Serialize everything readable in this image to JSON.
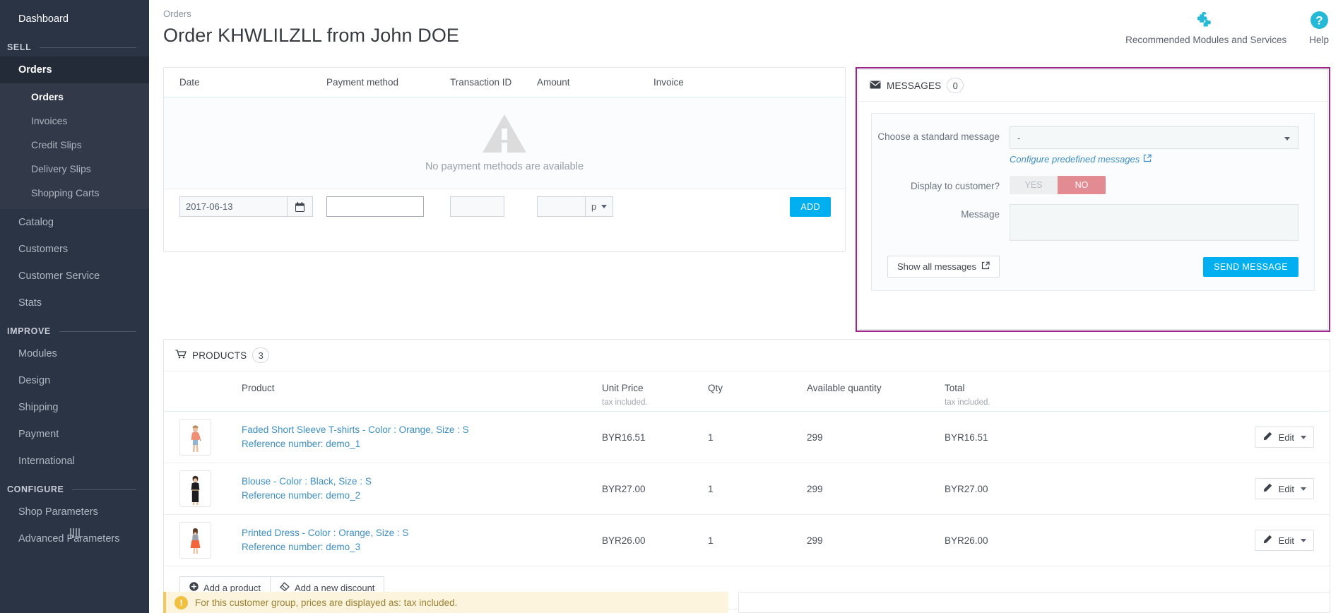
{
  "sidebar": {
    "dashboard": {
      "label": "Dashboard"
    },
    "sections": [
      {
        "title": "SELL",
        "items": [
          {
            "label": "Orders",
            "active": true,
            "submenu": [
              {
                "label": "Orders",
                "active": true
              },
              {
                "label": "Invoices",
                "active": false
              },
              {
                "label": "Credit Slips",
                "active": false
              },
              {
                "label": "Delivery Slips",
                "active": false
              },
              {
                "label": "Shopping Carts",
                "active": false
              }
            ]
          },
          {
            "label": "Catalog"
          },
          {
            "label": "Customers"
          },
          {
            "label": "Customer Service"
          },
          {
            "label": "Stats"
          }
        ]
      },
      {
        "title": "IMPROVE",
        "items": [
          {
            "label": "Modules"
          },
          {
            "label": "Design"
          },
          {
            "label": "Shipping"
          },
          {
            "label": "Payment"
          },
          {
            "label": "International"
          }
        ]
      },
      {
        "title": "CONFIGURE",
        "items": [
          {
            "label": "Shop Parameters"
          },
          {
            "label": "Advanced Parameters"
          }
        ]
      }
    ]
  },
  "header": {
    "breadcrumb": "Orders",
    "title": "Order KHWLILZLL from John DOE",
    "actions": [
      {
        "icon": "puzzle-piece-icon",
        "label": "Recommended Modules and Services"
      },
      {
        "icon": "help-circle-icon",
        "label": "Help"
      }
    ]
  },
  "payment": {
    "columns": [
      "Date",
      "Payment method",
      "Transaction ID",
      "Amount",
      "Invoice"
    ],
    "empty_message": "No payment methods are available",
    "form": {
      "date_value": "2017-06-13",
      "date_icon": "calendar-icon",
      "payment_method_value": "",
      "transaction_id_value": "",
      "amount_value": "",
      "currency_symbol": "p",
      "add_label": "ADD"
    }
  },
  "messages": {
    "title": "MESSAGES",
    "icon": "envelope-icon",
    "count": "0",
    "standard_message_label": "Choose a standard message",
    "standard_message_value": "-",
    "configure_link": "Configure predefined messages",
    "display_label": "Display to customer?",
    "display_yes": "YES",
    "display_no": "NO",
    "display_selected": "NO",
    "message_label": "Message",
    "message_value": "",
    "show_all_label": "Show all messages",
    "send_label": "SEND MESSAGE",
    "border_color": "#a0248c"
  },
  "products": {
    "title": "PRODUCTS",
    "icon": "cart-icon",
    "count": "3",
    "columns": {
      "product": "Product",
      "unit_price": "Unit Price",
      "unit_price_sub": "tax included.",
      "qty": "Qty",
      "available": "Available quantity",
      "total": "Total",
      "total_sub": "tax included."
    },
    "rows": [
      {
        "name": "Faded Short Sleeve T-shirts - Color : Orange, Size : S",
        "reference": "Reference number: demo_1",
        "unit_price": "BYR16.51",
        "qty": "1",
        "available": "299",
        "total": "BYR16.51",
        "edit_label": "Edit",
        "thumb": "tshirt"
      },
      {
        "name": "Blouse - Color : Black, Size : S",
        "reference": "Reference number: demo_2",
        "unit_price": "BYR27.00",
        "qty": "1",
        "available": "299",
        "total": "BYR27.00",
        "edit_label": "Edit",
        "thumb": "blouse"
      },
      {
        "name": "Printed Dress - Color : Orange, Size : S",
        "reference": "Reference number: demo_3",
        "unit_price": "BYR26.00",
        "qty": "1",
        "available": "299",
        "total": "BYR26.00",
        "edit_label": "Edit",
        "thumb": "dress"
      }
    ],
    "add_product_label": "Add a product",
    "add_discount_label": "Add a new discount"
  },
  "notice": {
    "icon": "exclamation-icon",
    "text": "For this customer group, prices are displayed as: tax included."
  },
  "colors": {
    "accent": "#00aff0",
    "sidebar_bg": "#2b3445",
    "link": "#3d8fc4",
    "warning_bg": "#fcf4dd",
    "messages_border": "#a0248c"
  }
}
